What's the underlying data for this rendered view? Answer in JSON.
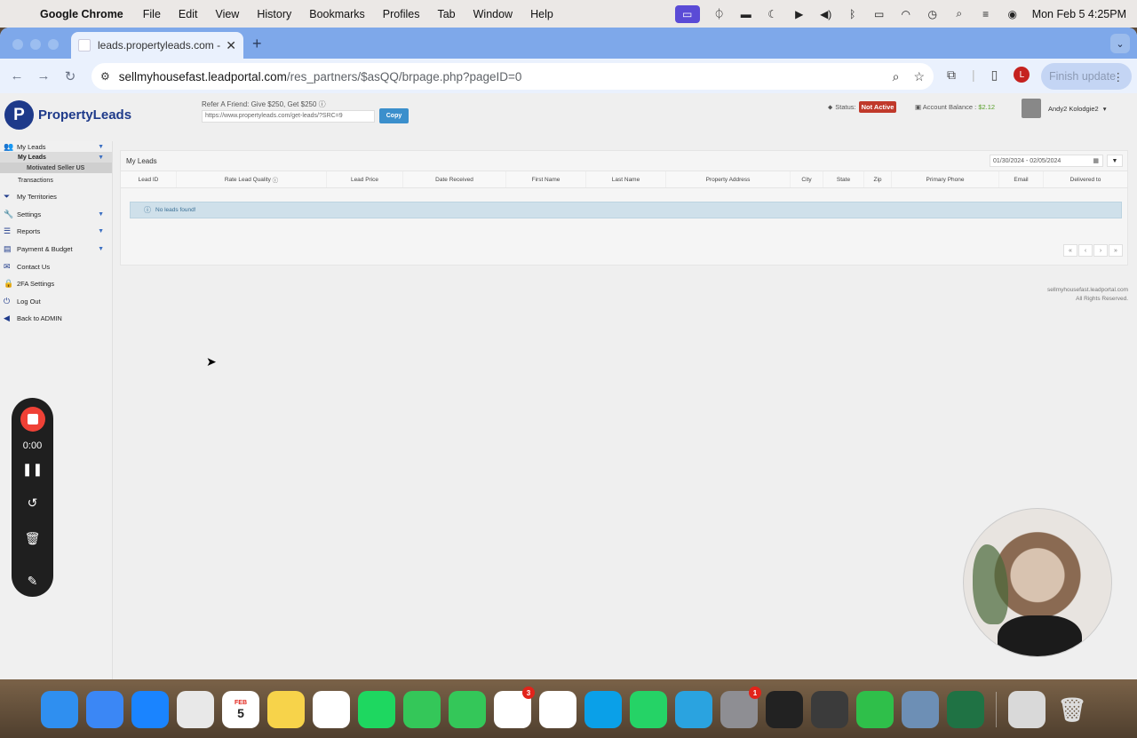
{
  "menubar": {
    "app": "Google Chrome",
    "items": [
      "File",
      "Edit",
      "View",
      "History",
      "Bookmarks",
      "Profiles",
      "Tab",
      "Window",
      "Help"
    ],
    "clock": "Mon Feb 5  4:25PM"
  },
  "browser": {
    "tab_title": "leads.propertyleads.com - M",
    "url_host": "sellmyhousefast.leadportal.com",
    "url_path": "/res_partners/$asQQ/brpage.php?pageID=0",
    "profile_initial": "L",
    "finish_update": "Finish update"
  },
  "header": {
    "logo_text": "PropertyLeads",
    "refer_label": "Refer A Friend: Give $250, Get $250",
    "refer_url": "https://www.propertyleads.com/get-leads/?SRC=9",
    "copy_label": "Copy",
    "status_label": "Status:",
    "status_value": "Not Active",
    "balance_label": "Account Balance :",
    "balance_value": "$2.12",
    "user_name": "Andy2 Kolodgie2"
  },
  "sidebar": {
    "my_leads": "My Leads",
    "my_leads_sub": "My Leads",
    "motivated": "Motivated Seller US",
    "transactions": "Transactions",
    "territories": "My Territories",
    "settings": "Settings",
    "reports": "Reports",
    "payment": "Payment & Budget",
    "contact": "Contact Us",
    "twofa": "2FA Settings",
    "logout": "Log Out",
    "back_admin": "Back to ADMIN"
  },
  "content": {
    "title": "My Leads",
    "date_range": "01/30/2024 - 02/05/2024",
    "columns": [
      "Lead ID",
      "Rate Lead Quality",
      "Lead Price",
      "Date Received",
      "First Name",
      "Last Name",
      "Property Address",
      "City",
      "State",
      "Zip",
      "Primary Phone",
      "Email",
      "Delivered to"
    ],
    "empty_message": "No leads found!",
    "footer_domain": "sellmyhousefast.leadportal.com",
    "footer_rights": "All Rights Reserved."
  },
  "recorder": {
    "time": "0:00"
  },
  "dock": {
    "calendar_month": "FEB",
    "calendar_day": "5",
    "slack_badge": "3",
    "settings_badge": "1",
    "apps": [
      {
        "name": "finder",
        "color": "#2f8ff0"
      },
      {
        "name": "mail",
        "color": "#3b87f5"
      },
      {
        "name": "safari",
        "color": "#1a84ff"
      },
      {
        "name": "chrome",
        "color": "#e8e8e8"
      },
      {
        "name": "calendar",
        "color": "#ffffff"
      },
      {
        "name": "notes",
        "color": "#f7d34a"
      },
      {
        "name": "photos",
        "color": "#ffffff"
      },
      {
        "name": "spotify",
        "color": "#1ed760"
      },
      {
        "name": "facetime",
        "color": "#34c759"
      },
      {
        "name": "messages",
        "color": "#34c759"
      },
      {
        "name": "slack",
        "color": "#ffffff"
      },
      {
        "name": "asana",
        "color": "#ffffff"
      },
      {
        "name": "skype",
        "color": "#0aa0e8"
      },
      {
        "name": "whatsapp",
        "color": "#25d366"
      },
      {
        "name": "telegram",
        "color": "#2aa3e0"
      },
      {
        "name": "system-settings",
        "color": "#8e8e93"
      },
      {
        "name": "terminal",
        "color": "#222222"
      },
      {
        "name": "sublime",
        "color": "#3b3b3b"
      },
      {
        "name": "numbers",
        "color": "#2fbf4a"
      },
      {
        "name": "preview",
        "color": "#6d8fb5"
      },
      {
        "name": "excel",
        "color": "#1f7244"
      }
    ]
  }
}
